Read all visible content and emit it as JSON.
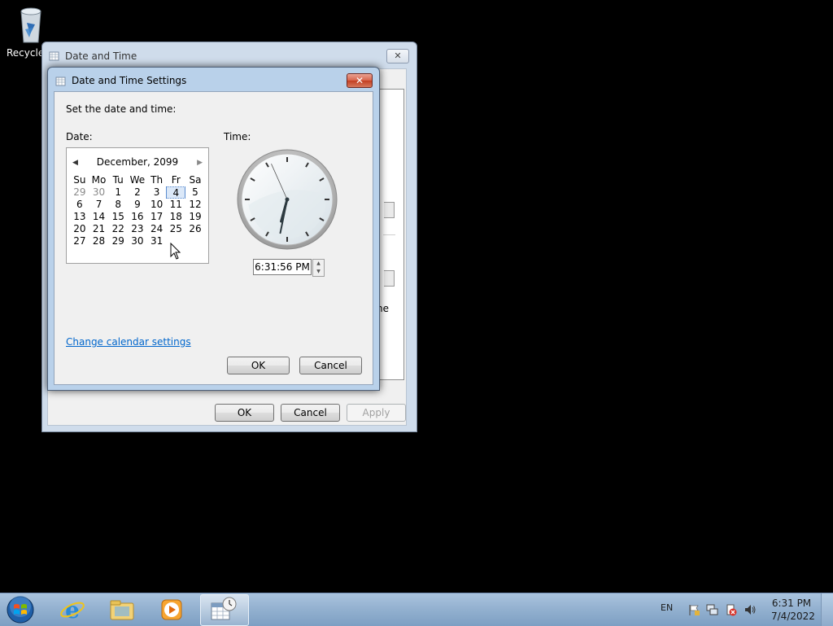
{
  "desktop": {
    "recycle_label": "Recycle"
  },
  "parent_window": {
    "title": "Date and Time",
    "close_glyph": "✕",
    "peek_text": "ne",
    "ok_label": "OK",
    "cancel_label": "Cancel",
    "apply_label": "Apply"
  },
  "dialog": {
    "title": "Date and Time Settings",
    "close_glyph": "✕",
    "instruction": "Set the date and time:",
    "date_label": "Date:",
    "time_label": "Time:",
    "calendar": {
      "month_year": "December, 2099",
      "prev_glyph": "◀",
      "next_glyph": "▶",
      "weekdays": [
        "Su",
        "Mo",
        "Tu",
        "We",
        "Th",
        "Fr",
        "Sa"
      ],
      "weeks": [
        [
          "29",
          "30",
          "1",
          "2",
          "3",
          "4",
          "5"
        ],
        [
          "6",
          "7",
          "8",
          "9",
          "10",
          "11",
          "12"
        ],
        [
          "13",
          "14",
          "15",
          "16",
          "17",
          "18",
          "19"
        ],
        [
          "20",
          "21",
          "22",
          "23",
          "24",
          "25",
          "26"
        ],
        [
          "27",
          "28",
          "29",
          "30",
          "31",
          "",
          ""
        ]
      ],
      "selected_day": "4"
    },
    "clock": {
      "hours": 6,
      "minutes": 31,
      "seconds": 56
    },
    "time_value": "6:31:56 PM",
    "change_calendar_link": "Change calendar settings",
    "ok_label": "OK",
    "cancel_label": "Cancel"
  },
  "taskbar": {
    "pinned": [
      "internet-explorer-icon",
      "file-explorer-icon",
      "media-player-icon",
      "date-time-icon"
    ],
    "language": "EN",
    "clock_time": "6:31 PM",
    "clock_date": "7/4/2022"
  },
  "colors": {
    "desktop": "#000000",
    "dialog_frame": "#b9d1ea",
    "close_red": "#c33f22",
    "link": "#0066cc",
    "taskbar": "#92b0cf"
  }
}
